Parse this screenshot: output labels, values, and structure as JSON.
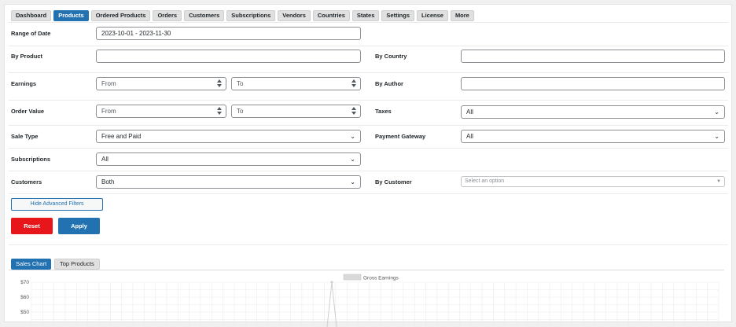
{
  "tabs": [
    {
      "label": "Dashboard",
      "active": false
    },
    {
      "label": "Products",
      "active": true
    },
    {
      "label": "Ordered Products",
      "active": false
    },
    {
      "label": "Orders",
      "active": false
    },
    {
      "label": "Customers",
      "active": false
    },
    {
      "label": "Subscriptions",
      "active": false
    },
    {
      "label": "Vendors",
      "active": false
    },
    {
      "label": "Countries",
      "active": false
    },
    {
      "label": "States",
      "active": false
    },
    {
      "label": "Settings",
      "active": false
    },
    {
      "label": "License",
      "active": false
    },
    {
      "label": "More",
      "active": false
    }
  ],
  "filters": {
    "range_of_date": {
      "label": "Range of Date",
      "value": "2023-10-01 - 2023-11-30"
    },
    "by_product": {
      "label": "By Product",
      "value": ""
    },
    "by_country": {
      "label": "By Country",
      "value": ""
    },
    "earnings": {
      "label": "Earnings",
      "from_placeholder": "From",
      "to_placeholder": "To"
    },
    "by_author": {
      "label": "By Author",
      "value": ""
    },
    "order_value": {
      "label": "Order Value",
      "from_placeholder": "From",
      "to_placeholder": "To"
    },
    "taxes": {
      "label": "Taxes",
      "value": "All"
    },
    "sale_type": {
      "label": "Sale Type",
      "value": "Free and Paid"
    },
    "payment_gateway": {
      "label": "Payment Gateway",
      "value": "All"
    },
    "subscriptions": {
      "label": "Subscriptions",
      "value": "All"
    },
    "customers": {
      "label": "Customers",
      "value": "Both"
    },
    "by_customer": {
      "label": "By Customer",
      "placeholder": "Select an option"
    }
  },
  "buttons": {
    "hide_filters": "Hide Advanced Filters",
    "reset": "Reset",
    "apply": "Apply"
  },
  "chart_tabs": {
    "sales_chart": "Sales Chart",
    "top_products": "Top Products"
  },
  "colors": {
    "accent": "#2271b1",
    "reset": "#e7161b"
  },
  "chart_data": {
    "type": "line",
    "series": [
      {
        "name": "Gross Earnings",
        "color": "#d9d9d9"
      }
    ],
    "y_ticks": [
      "$70",
      "$60",
      "$50"
    ],
    "ylim": [
      45,
      70
    ],
    "grid": true,
    "legend": "top-center",
    "spike": {
      "value": 70
    }
  }
}
